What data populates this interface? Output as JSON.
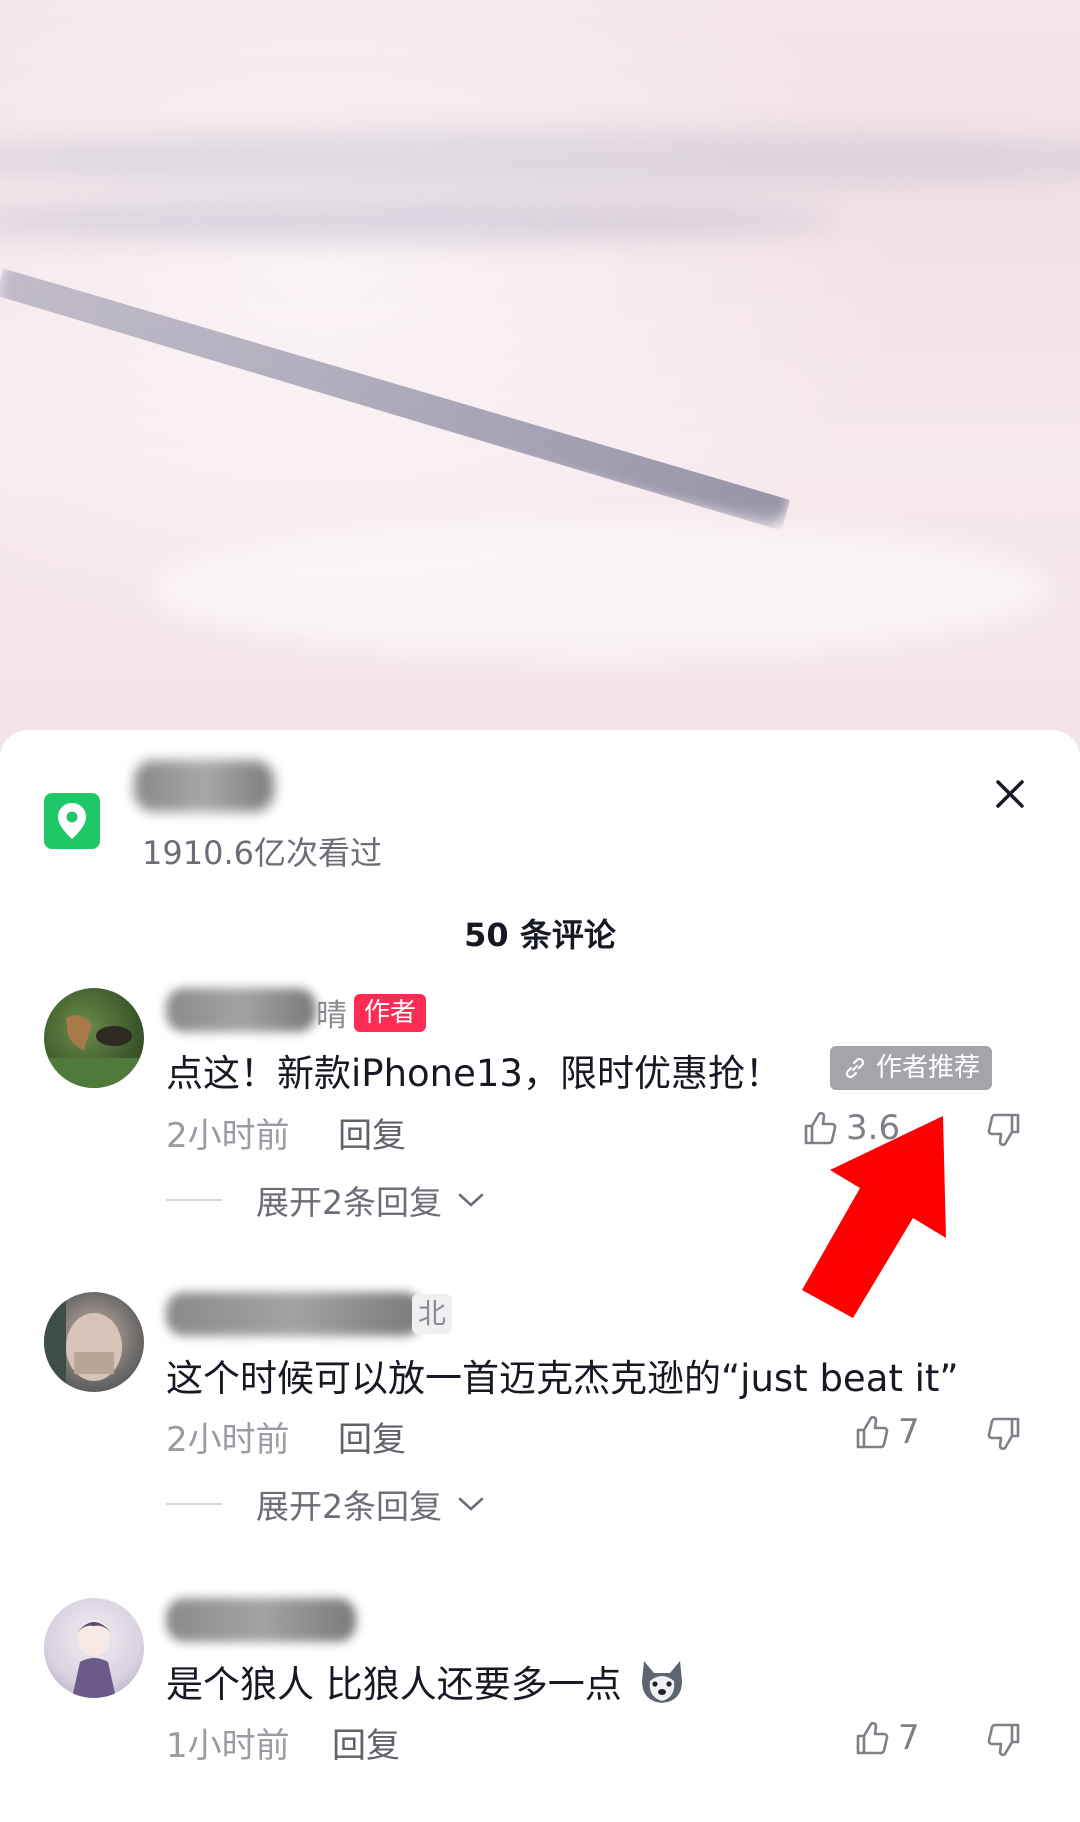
{
  "location": {
    "views": "1910.6亿次看过",
    "pin_color": "#1ec867"
  },
  "comments_header": "50 条评论",
  "comments": [
    {
      "name_suffix": "晴",
      "author_tag": "作者",
      "text": "点这！新款iPhone13，限时优惠抢！",
      "recommend_tag": "作者推荐",
      "time": "2小时前",
      "reply": "回复",
      "likes": "3.6",
      "expand": "展开2条回复"
    },
    {
      "location_tag": "北",
      "text": "这个时候可以放一首迈克杰克逊的“just beat it”",
      "time": "2小时前",
      "reply": "回复",
      "likes": "7",
      "expand": "展开2条回复"
    },
    {
      "text": "是个狼人  比狼人还要多一点",
      "time": "1小时前",
      "reply": "回复",
      "likes": "7"
    }
  ],
  "colors": {
    "author_tag": "#fe2c55",
    "arrow": "#ff0000"
  }
}
